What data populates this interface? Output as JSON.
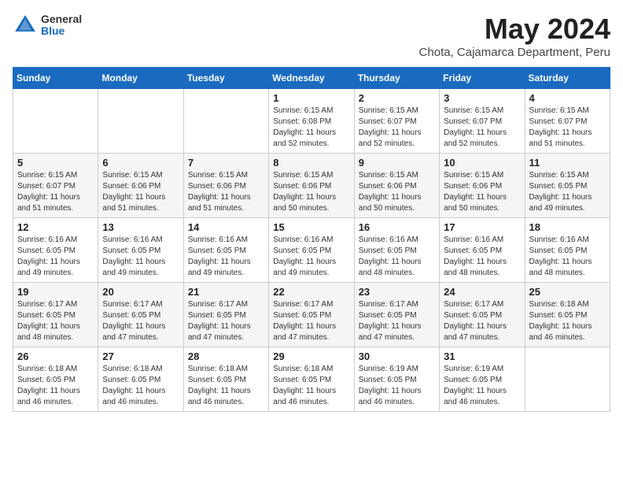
{
  "header": {
    "logo_general": "General",
    "logo_blue": "Blue",
    "month_year": "May 2024",
    "location": "Chota, Cajamarca Department, Peru"
  },
  "weekdays": [
    "Sunday",
    "Monday",
    "Tuesday",
    "Wednesday",
    "Thursday",
    "Friday",
    "Saturday"
  ],
  "weeks": [
    [
      {
        "day": "",
        "sunrise": "",
        "sunset": "",
        "daylight": ""
      },
      {
        "day": "",
        "sunrise": "",
        "sunset": "",
        "daylight": ""
      },
      {
        "day": "",
        "sunrise": "",
        "sunset": "",
        "daylight": ""
      },
      {
        "day": "1",
        "sunrise": "Sunrise: 6:15 AM",
        "sunset": "Sunset: 6:08 PM",
        "daylight": "Daylight: 11 hours and 52 minutes."
      },
      {
        "day": "2",
        "sunrise": "Sunrise: 6:15 AM",
        "sunset": "Sunset: 6:07 PM",
        "daylight": "Daylight: 11 hours and 52 minutes."
      },
      {
        "day": "3",
        "sunrise": "Sunrise: 6:15 AM",
        "sunset": "Sunset: 6:07 PM",
        "daylight": "Daylight: 11 hours and 52 minutes."
      },
      {
        "day": "4",
        "sunrise": "Sunrise: 6:15 AM",
        "sunset": "Sunset: 6:07 PM",
        "daylight": "Daylight: 11 hours and 51 minutes."
      }
    ],
    [
      {
        "day": "5",
        "sunrise": "Sunrise: 6:15 AM",
        "sunset": "Sunset: 6:07 PM",
        "daylight": "Daylight: 11 hours and 51 minutes."
      },
      {
        "day": "6",
        "sunrise": "Sunrise: 6:15 AM",
        "sunset": "Sunset: 6:06 PM",
        "daylight": "Daylight: 11 hours and 51 minutes."
      },
      {
        "day": "7",
        "sunrise": "Sunrise: 6:15 AM",
        "sunset": "Sunset: 6:06 PM",
        "daylight": "Daylight: 11 hours and 51 minutes."
      },
      {
        "day": "8",
        "sunrise": "Sunrise: 6:15 AM",
        "sunset": "Sunset: 6:06 PM",
        "daylight": "Daylight: 11 hours and 50 minutes."
      },
      {
        "day": "9",
        "sunrise": "Sunrise: 6:15 AM",
        "sunset": "Sunset: 6:06 PM",
        "daylight": "Daylight: 11 hours and 50 minutes."
      },
      {
        "day": "10",
        "sunrise": "Sunrise: 6:15 AM",
        "sunset": "Sunset: 6:06 PM",
        "daylight": "Daylight: 11 hours and 50 minutes."
      },
      {
        "day": "11",
        "sunrise": "Sunrise: 6:15 AM",
        "sunset": "Sunset: 6:05 PM",
        "daylight": "Daylight: 11 hours and 49 minutes."
      }
    ],
    [
      {
        "day": "12",
        "sunrise": "Sunrise: 6:16 AM",
        "sunset": "Sunset: 6:05 PM",
        "daylight": "Daylight: 11 hours and 49 minutes."
      },
      {
        "day": "13",
        "sunrise": "Sunrise: 6:16 AM",
        "sunset": "Sunset: 6:05 PM",
        "daylight": "Daylight: 11 hours and 49 minutes."
      },
      {
        "day": "14",
        "sunrise": "Sunrise: 6:16 AM",
        "sunset": "Sunset: 6:05 PM",
        "daylight": "Daylight: 11 hours and 49 minutes."
      },
      {
        "day": "15",
        "sunrise": "Sunrise: 6:16 AM",
        "sunset": "Sunset: 6:05 PM",
        "daylight": "Daylight: 11 hours and 49 minutes."
      },
      {
        "day": "16",
        "sunrise": "Sunrise: 6:16 AM",
        "sunset": "Sunset: 6:05 PM",
        "daylight": "Daylight: 11 hours and 48 minutes."
      },
      {
        "day": "17",
        "sunrise": "Sunrise: 6:16 AM",
        "sunset": "Sunset: 6:05 PM",
        "daylight": "Daylight: 11 hours and 48 minutes."
      },
      {
        "day": "18",
        "sunrise": "Sunrise: 6:16 AM",
        "sunset": "Sunset: 6:05 PM",
        "daylight": "Daylight: 11 hours and 48 minutes."
      }
    ],
    [
      {
        "day": "19",
        "sunrise": "Sunrise: 6:17 AM",
        "sunset": "Sunset: 6:05 PM",
        "daylight": "Daylight: 11 hours and 48 minutes."
      },
      {
        "day": "20",
        "sunrise": "Sunrise: 6:17 AM",
        "sunset": "Sunset: 6:05 PM",
        "daylight": "Daylight: 11 hours and 47 minutes."
      },
      {
        "day": "21",
        "sunrise": "Sunrise: 6:17 AM",
        "sunset": "Sunset: 6:05 PM",
        "daylight": "Daylight: 11 hours and 47 minutes."
      },
      {
        "day": "22",
        "sunrise": "Sunrise: 6:17 AM",
        "sunset": "Sunset: 6:05 PM",
        "daylight": "Daylight: 11 hours and 47 minutes."
      },
      {
        "day": "23",
        "sunrise": "Sunrise: 6:17 AM",
        "sunset": "Sunset: 6:05 PM",
        "daylight": "Daylight: 11 hours and 47 minutes."
      },
      {
        "day": "24",
        "sunrise": "Sunrise: 6:17 AM",
        "sunset": "Sunset: 6:05 PM",
        "daylight": "Daylight: 11 hours and 47 minutes."
      },
      {
        "day": "25",
        "sunrise": "Sunrise: 6:18 AM",
        "sunset": "Sunset: 6:05 PM",
        "daylight": "Daylight: 11 hours and 46 minutes."
      }
    ],
    [
      {
        "day": "26",
        "sunrise": "Sunrise: 6:18 AM",
        "sunset": "Sunset: 6:05 PM",
        "daylight": "Daylight: 11 hours and 46 minutes."
      },
      {
        "day": "27",
        "sunrise": "Sunrise: 6:18 AM",
        "sunset": "Sunset: 6:05 PM",
        "daylight": "Daylight: 11 hours and 46 minutes."
      },
      {
        "day": "28",
        "sunrise": "Sunrise: 6:18 AM",
        "sunset": "Sunset: 6:05 PM",
        "daylight": "Daylight: 11 hours and 46 minutes."
      },
      {
        "day": "29",
        "sunrise": "Sunrise: 6:18 AM",
        "sunset": "Sunset: 6:05 PM",
        "daylight": "Daylight: 11 hours and 46 minutes."
      },
      {
        "day": "30",
        "sunrise": "Sunrise: 6:19 AM",
        "sunset": "Sunset: 6:05 PM",
        "daylight": "Daylight: 11 hours and 46 minutes."
      },
      {
        "day": "31",
        "sunrise": "Sunrise: 6:19 AM",
        "sunset": "Sunset: 6:05 PM",
        "daylight": "Daylight: 11 hours and 46 minutes."
      },
      {
        "day": "",
        "sunrise": "",
        "sunset": "",
        "daylight": ""
      }
    ]
  ]
}
